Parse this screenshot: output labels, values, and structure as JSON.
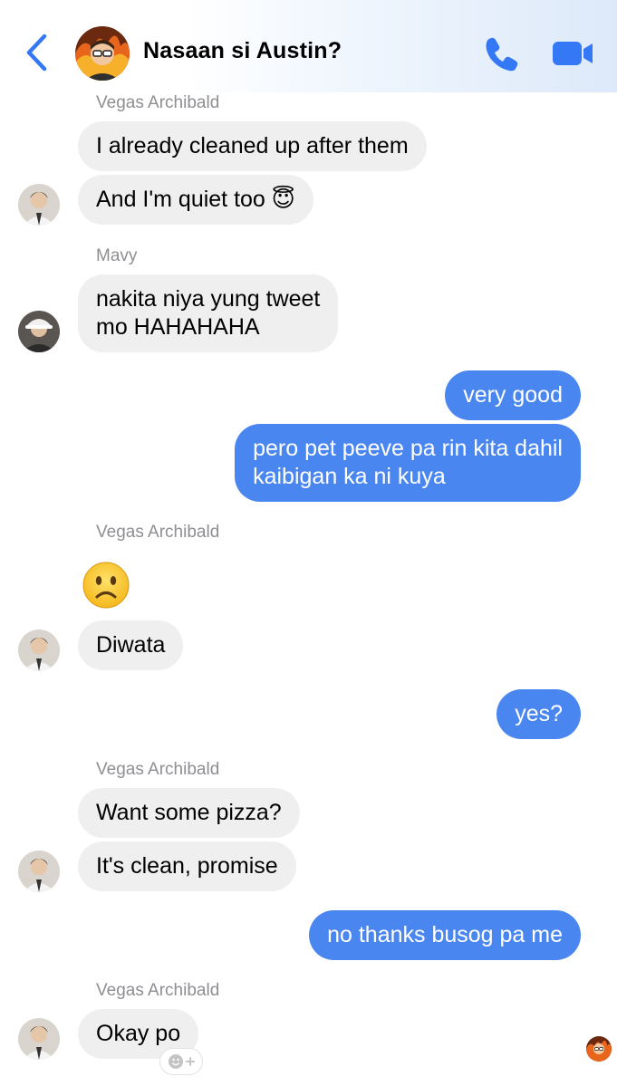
{
  "header": {
    "title": "Nasaan si Austin?",
    "back_icon": "chevron-left-icon",
    "call_icon": "phone-icon",
    "video_icon": "video-camera-icon",
    "accent_color": "#3478f6"
  },
  "messages": [
    {
      "id": "m1",
      "sender": "Vegas Archibald",
      "text": "I already cleaned up after them",
      "direction": "incoming"
    },
    {
      "id": "m2",
      "text": "And I'm quiet too 😇",
      "direction": "incoming"
    },
    {
      "id": "m3",
      "sender": "Mavy",
      "lines": [
        "nakita niya yung tweet",
        "mo HAHAHAHA"
      ],
      "direction": "incoming"
    },
    {
      "id": "m4",
      "text": "very good",
      "direction": "outgoing"
    },
    {
      "id": "m5",
      "lines": [
        "pero pet peeve pa rin kita dahil",
        "kaibigan ka ni kuya"
      ],
      "direction": "outgoing"
    },
    {
      "id": "m6",
      "sender": "Vegas Archibald",
      "emoji": "🙁",
      "direction": "incoming"
    },
    {
      "id": "m7",
      "text": "Diwata",
      "direction": "incoming"
    },
    {
      "id": "m8",
      "text": "yes?",
      "direction": "outgoing"
    },
    {
      "id": "m9",
      "sender": "Vegas Archibald",
      "text": "Want some pizza?",
      "direction": "incoming"
    },
    {
      "id": "m10",
      "text": "It's clean, promise",
      "direction": "incoming"
    },
    {
      "id": "m11",
      "text": "no thanks busog pa me",
      "direction": "outgoing"
    },
    {
      "id": "m12",
      "sender": "Vegas Archibald",
      "text": "Okay po",
      "direction": "incoming"
    }
  ],
  "reaction_button": {
    "icon": "add-reaction-icon",
    "label": "+"
  },
  "colors": {
    "incoming_bubble": "#efefef",
    "outgoing_bubble": "#4a86f0",
    "sender_text": "#8e8e93"
  }
}
